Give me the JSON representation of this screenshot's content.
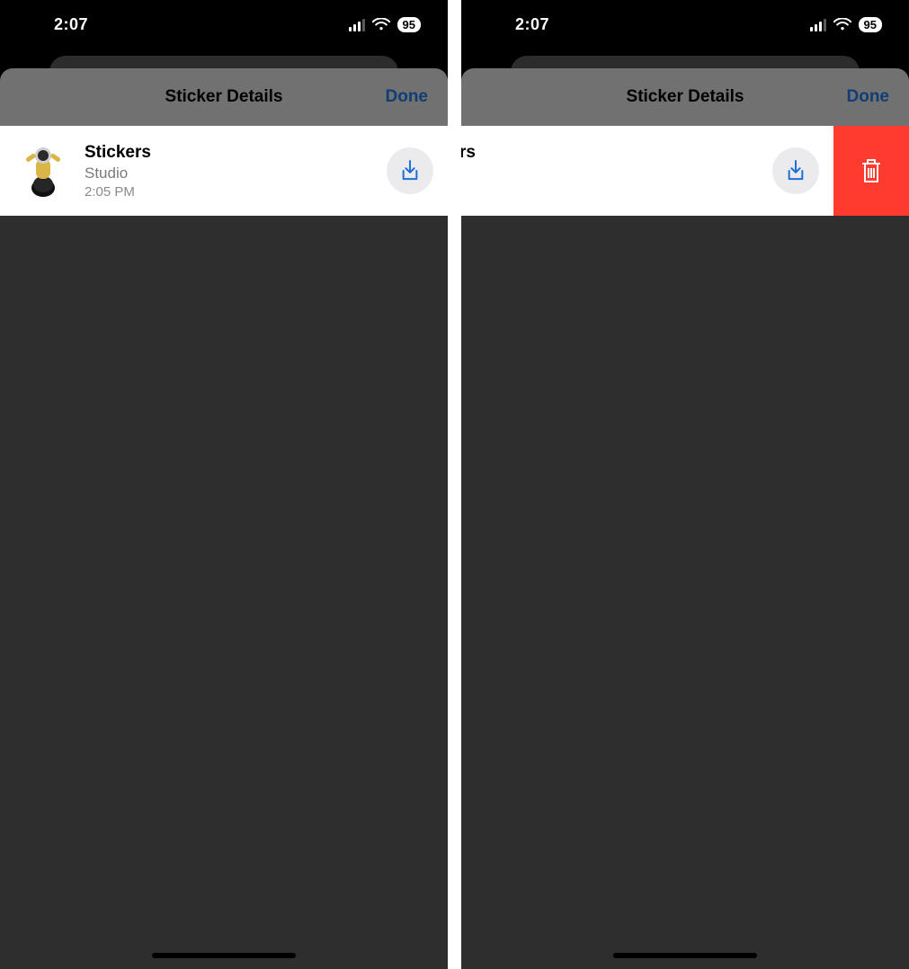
{
  "status": {
    "time": "2:07",
    "battery": "95"
  },
  "modal": {
    "title": "Sticker Details",
    "done": "Done"
  },
  "item": {
    "title": "Stickers",
    "subtitle": "Studio",
    "time": "2:05 PM"
  },
  "colors": {
    "accent": "#1f6fd6",
    "destructive": "#ff3b30"
  }
}
